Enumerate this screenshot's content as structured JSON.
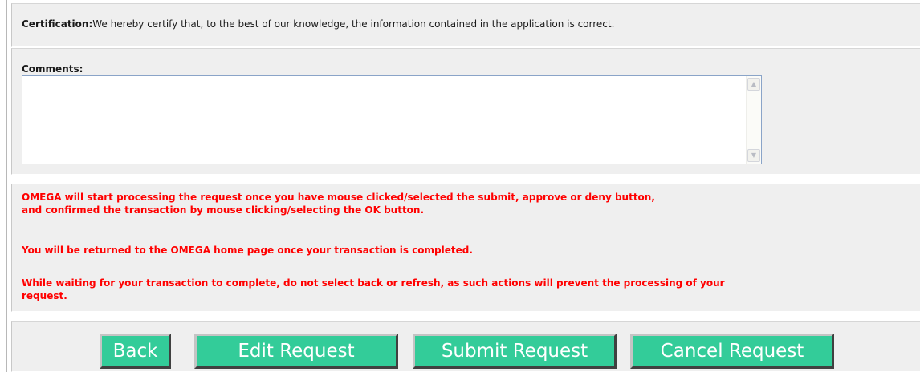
{
  "certification": {
    "label": "Certification:",
    "text": "We hereby certify that, to the best of our knowledge, the information contained in the application is correct."
  },
  "comments": {
    "label": "Comments:",
    "value": ""
  },
  "notice": {
    "line1": "OMEGA will start processing the request once you have mouse clicked/selected the submit, approve or deny button,",
    "line2": "and confirmed the transaction by mouse clicking/selecting the OK button.",
    "line3": "You will be returned to the OMEGA home page once your transaction is completed.",
    "line4": "While waiting for your transaction to complete, do not select back or refresh, as such actions will prevent the processing of your",
    "line5": "request.",
    "color": "#ff0000"
  },
  "actions": {
    "back_label": "Back",
    "edit_label": "Edit Request",
    "submit_label": "Submit Request",
    "cancel_label": "Cancel Request",
    "button_color": "#33cc99"
  },
  "icons": {
    "scroll_up": "scroll-up-arrow-icon",
    "scroll_down": "scroll-down-arrow-icon"
  }
}
